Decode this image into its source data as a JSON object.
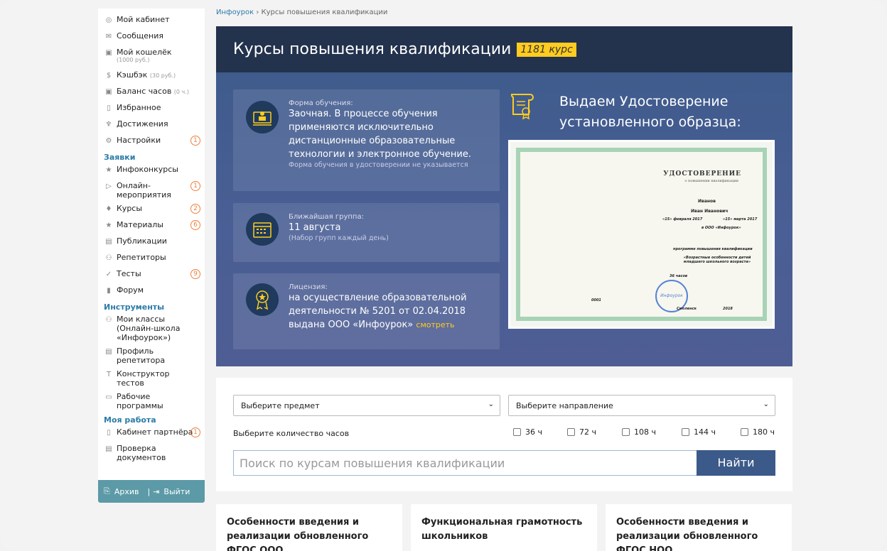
{
  "breadcrumb": {
    "home": "Инфоурок",
    "sep": "›",
    "current": "Курсы повышения квалификации"
  },
  "sidebar": {
    "items": [
      {
        "label": "Мой кабинет",
        "icon": "user-icon"
      },
      {
        "label": "Сообщения",
        "icon": "mail-icon"
      },
      {
        "label": "Мой кошелёк",
        "sub": "(1000 руб.)",
        "icon": "wallet-icon"
      },
      {
        "label": "Кэшбэк",
        "muted": "(30 руб.)",
        "icon": "cashback-icon"
      },
      {
        "label": "Баланс часов",
        "muted": "(0 ч.)",
        "icon": "hours-icon"
      },
      {
        "label": "Избранное",
        "icon": "bookmark-icon"
      },
      {
        "label": "Достижения",
        "icon": "trophy-icon"
      },
      {
        "label": "Настройки",
        "badge": "1",
        "icon": "gear-icon"
      }
    ],
    "section_requests": "Заявки",
    "requests": [
      {
        "label": "Инфоконкурсы",
        "icon": "star-icon"
      },
      {
        "label": "Онлайн-мероприятия",
        "badge": "1",
        "icon": "play-icon"
      },
      {
        "label": "Курсы",
        "badge": "2",
        "icon": "graduation-icon"
      },
      {
        "label": "Материалы",
        "badge": "6",
        "icon": "star-icon"
      },
      {
        "label": "Публикации",
        "icon": "publication-icon"
      },
      {
        "label": "Репетиторы",
        "icon": "people-icon"
      },
      {
        "label": "Тесты",
        "badge": "9",
        "icon": "check-icon"
      },
      {
        "label": "Форум",
        "icon": "forum-icon"
      }
    ],
    "section_tools": "Инструменты",
    "tools": [
      {
        "label": "Мои классы (Онлайн-школа «Инфоурок»)",
        "icon": "classes-icon"
      },
      {
        "label": "Профиль репетитора",
        "icon": "profile-icon"
      },
      {
        "label": "Конструктор тестов",
        "icon": "text-icon"
      },
      {
        "label": "Рабочие программы",
        "icon": "calendar-icon"
      }
    ],
    "section_work": "Моя работа",
    "work": [
      {
        "label": "Кабинет партнёра",
        "badge": "1",
        "icon": "document-icon"
      },
      {
        "label": "Проверка документов",
        "icon": "doc-check-icon"
      }
    ],
    "archive": "Архив",
    "logout": "Выйти"
  },
  "hero": {
    "title": "Курсы повышения квалификации",
    "count": "1181 курс",
    "form": {
      "caption": "Форма обучения:",
      "text": "Заочная. В процессе обучения применяются исключительно дистанционные образовательные технологии и электронное обучение.",
      "hint": "Форма обучения в удостоверении не указывается"
    },
    "group": {
      "caption": "Ближайшая группа:",
      "text": "11 августа",
      "hint": "(Набор групп каждый день)"
    },
    "license": {
      "caption": "Лицензия:",
      "text": "на осуществление образовательной деятельности № 5201 от 02.04.2018 выдана ООО «Инфоурок»",
      "link": "смотреть"
    },
    "cert_title": "Выдаем Удостоверение установленного образца:",
    "cert": {
      "heading": "УДОСТОВЕРЕНИЕ",
      "subheading": "о повышении квалификации",
      "surname": "Иванов",
      "name": "Иван Иванович",
      "from": "«15» февраля 2017",
      "to": "«15» марта 2017",
      "org": "в ООО «Инфоурок»",
      "program": "программе повышения квалификации",
      "program_name": "«Возрастные особенности детей младшего школьного возраста»",
      "hours": "36 часов",
      "reg": "0001",
      "year": "2018",
      "city": "Смоленск"
    }
  },
  "filters": {
    "subject": "Выберите предмет",
    "direction": "Выберите направление",
    "hours_label": "Выберите количество часов",
    "hours": [
      "36 ч",
      "72 ч",
      "108 ч",
      "144 ч",
      "180 ч"
    ],
    "search_placeholder": "Поиск по курсам повышения квалификации",
    "search_button": "Найти"
  },
  "courses": [
    "Особенности введения и реализации обновленного ФГОС ООО",
    "Функциональная грамотность школьников",
    "Особенности введения и реализации обновленного ФГОС НОО"
  ]
}
